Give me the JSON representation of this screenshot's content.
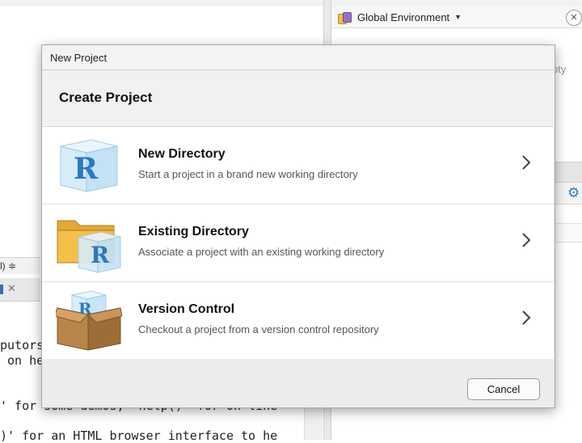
{
  "background": {
    "environment_label": "Global Environment",
    "empty_text": "pty",
    "console_toolbar_text": "l) ≑",
    "console_lines": [
      "putors",
      " on he",
      "' for some demos, 'help()' for on-line",
      ")' for an HTML browser interface to he"
    ]
  },
  "dialog": {
    "window_title": "New Project",
    "heading": "Create Project",
    "options": [
      {
        "title": "New Directory",
        "description": "Start a project in a brand new working directory",
        "icon": "r-cube-icon"
      },
      {
        "title": "Existing Directory",
        "description": "Associate a project with an existing working directory",
        "icon": "folder-r-cube-icon"
      },
      {
        "title": "Version Control",
        "description": "Checkout a project from a version control repository",
        "icon": "box-r-cube-icon"
      }
    ],
    "cancel_label": "Cancel"
  },
  "colors": {
    "r_blue": "#2b78c4",
    "cube_face": "#d7ecf8",
    "folder_yellow": "#f4c04a",
    "box_brown": "#b9864a"
  }
}
